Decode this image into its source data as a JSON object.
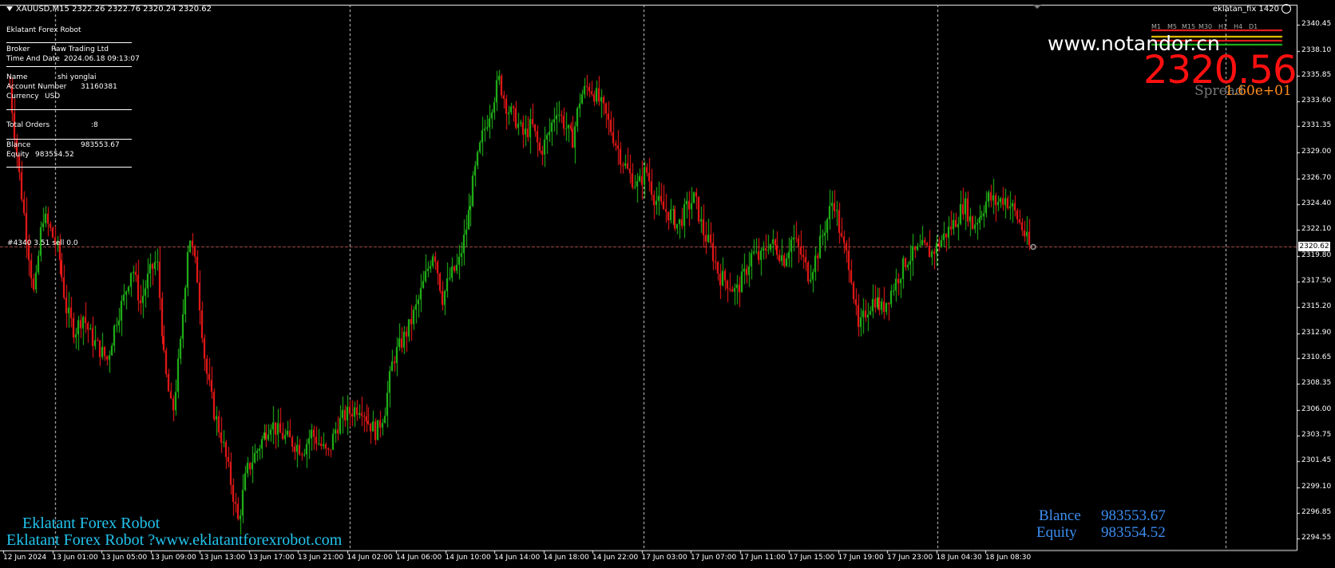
{
  "header": {
    "symbol_info": "XAUUSD,M15  2322.26 2322.76 2320.24 2320.62"
  },
  "info_panel": {
    "title": "Eklatant Forex Robot",
    "broker_label": "Broker",
    "broker_value": "Raw Trading Ltd",
    "time_label": "Time And Date",
    "time_value": "2024.06.18 09:13:07",
    "name_label": "Name",
    "name_value": "shi yonglai",
    "account_label": "Account Number",
    "account_value": "31160381",
    "currency_label": "Currency",
    "currency_value": "USD",
    "orders_label": "Total Orders",
    "orders_value": ":8",
    "balance_label": "Blance",
    "balance_value": "983553.67",
    "equity_label": "Equity",
    "equity_value": "983554.52"
  },
  "expert": {
    "name": "eklatan_fix 1420",
    "icon": "smiley-icon"
  },
  "overlay": {
    "website": "www.notandor.cn",
    "big_price": "2320.56",
    "spread_label": "Spread",
    "spread_value": "1.60e+01",
    "timeframes": [
      "M1",
      "M5",
      "M15",
      "M30",
      "H1",
      "H4",
      "D1"
    ]
  },
  "order_line": {
    "label": "#4340 3.51 sell 0.0"
  },
  "bottom_panel": {
    "balance_label": "Blance",
    "balance_value": "983553.67",
    "equity_label": "Equity",
    "equity_value": "983554.52"
  },
  "branding": {
    "line1": "Eklatant Forex Robot",
    "line2": "Eklatant Forex Robot ?www.eklatantforexrobot.com"
  },
  "colors": {
    "bull": "#22c51a",
    "bear": "#ff1a1a",
    "grid": "#ffffff",
    "price_line": "#b05050"
  },
  "chart_data": {
    "type": "candlestick",
    "symbol": "XAUUSD",
    "timeframe": "M15",
    "current_price": 2320.62,
    "ylim": [
      2293.5,
      2342.2
    ],
    "y_ticks": [
      "2340.45",
      "2338.10",
      "2335.85",
      "2333.60",
      "2331.35",
      "2329.00",
      "2326.70",
      "2324.40",
      "2322.10",
      "2319.80",
      "2317.50",
      "2315.20",
      "2312.90",
      "2310.65",
      "2308.35",
      "2306.00",
      "2303.75",
      "2301.45",
      "2299.10",
      "2296.85",
      "2294.55"
    ],
    "y_tick_values": [
      2340.45,
      2338.1,
      2335.85,
      2333.6,
      2331.35,
      2329.0,
      2326.7,
      2324.4,
      2322.1,
      2319.8,
      2317.5,
      2315.2,
      2312.9,
      2310.65,
      2308.35,
      2306.0,
      2303.75,
      2301.45,
      2299.1,
      2296.85,
      2294.55
    ],
    "x_ticks": [
      "12 Jun 2024",
      "13 Jun 01:00",
      "13 Jun 05:00",
      "13 Jun 09:00",
      "13 Jun 13:00",
      "13 Jun 17:00",
      "13 Jun 21:00",
      "14 Jun 02:00",
      "14 Jun 06:00",
      "14 Jun 10:00",
      "14 Jun 14:00",
      "14 Jun 18:00",
      "14 Jun 22:00",
      "17 Jun 03:00",
      "17 Jun 07:00",
      "17 Jun 11:00",
      "17 Jun 15:00",
      "17 Jun 19:00",
      "17 Jun 23:00",
      "18 Jun 04:30",
      "18 Jun 08:30"
    ],
    "close_path": [
      2335.0,
      2328.0,
      2322.0,
      2316.0,
      2323.5,
      2322.0,
      2320.0,
      2315.0,
      2313.0,
      2314.5,
      2312.5,
      2311.5,
      2310.5,
      2314.0,
      2316.0,
      2319.0,
      2315.5,
      2318.0,
      2319.5,
      2310.0,
      2305.5,
      2312.0,
      2322.0,
      2318.0,
      2310.0,
      2306.0,
      2303.5,
      2300.0,
      2296.0,
      2300.5,
      2302.0,
      2303.5,
      2305.0,
      2304.0,
      2303.5,
      2303.0,
      2302.5,
      2304.0,
      2303.0,
      2302.0,
      2304.5,
      2305.5,
      2306.0,
      2306.5,
      2305.0,
      2304.0,
      2306.0,
      2310.5,
      2312.0,
      2313.5,
      2315.5,
      2318.0,
      2320.5,
      2316.0,
      2318.0,
      2319.0,
      2322.5,
      2327.0,
      2330.5,
      2333.0,
      2335.5,
      2333.0,
      2332.0,
      2330.5,
      2331.5,
      2329.0,
      2330.5,
      2333.0,
      2331.5,
      2330.0,
      2334.0,
      2335.0,
      2334.0,
      2332.5,
      2330.5,
      2328.5,
      2327.0,
      2326.0,
      2327.5,
      2325.0,
      2324.0,
      2323.5,
      2322.5,
      2324.0,
      2325.0,
      2322.0,
      2320.5,
      2318.0,
      2317.5,
      2316.5,
      2318.0,
      2320.0,
      2319.5,
      2321.0,
      2320.5,
      2319.5,
      2321.5,
      2320.0,
      2318.0,
      2320.0,
      2322.5,
      2325.0,
      2321.0,
      2319.0,
      2313.0,
      2315.0,
      2316.0,
      2315.0,
      2316.5,
      2318.0,
      2319.5,
      2320.0,
      2320.5,
      2320.0,
      2321.0,
      2322.0,
      2323.0,
      2324.5,
      2322.5,
      2323.5,
      2325.0,
      2324.5,
      2325.0,
      2324.0,
      2322.5,
      2320.6
    ]
  }
}
